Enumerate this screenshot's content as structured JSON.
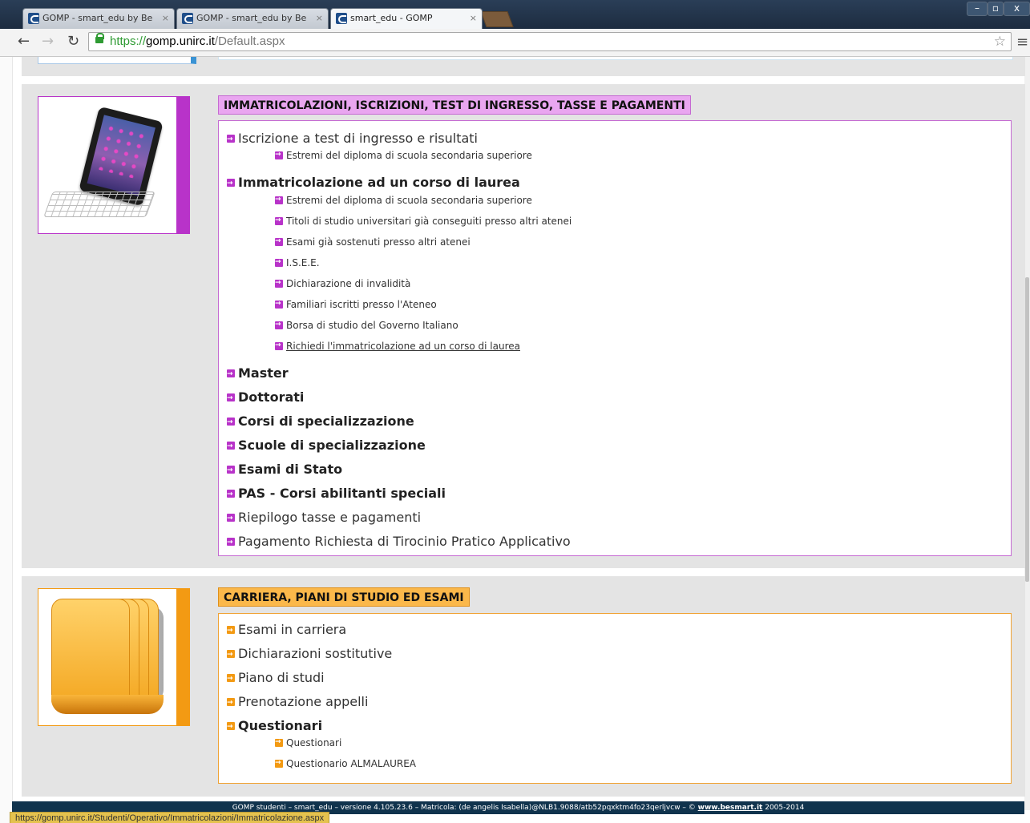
{
  "browser": {
    "tabs": [
      {
        "title": "GOMP - smart_edu by Be",
        "active": false
      },
      {
        "title": "GOMP - smart_edu by Be",
        "active": false
      },
      {
        "title": "smart_edu - GOMP",
        "active": true
      }
    ],
    "tab_close_glyph": "×",
    "url_scheme": "https://",
    "url_host": "gomp.unirc.it",
    "url_path": "/Default.aspx",
    "status_url": "https://gomp.unirc.it/Studenti/Operativo/Immatricolazioni/Immatricolazione.aspx"
  },
  "colors": {
    "purple_accent": "#b833c9",
    "purple_heading_bg": "#e9a6f0",
    "orange_accent": "#f39a13",
    "orange_heading_bg": "#fbb84a",
    "footer_bg": "#10334d"
  },
  "section_immatricolazioni": {
    "title": "IMMATRICOLAZIONI, ISCRIZIONI, TEST DI INGRESSO, TASSE E PAGAMENTI",
    "image_icon": "tablet-keyboard-icon",
    "items": {
      "test_ingresso": "Iscrizione a test di ingresso e risultati",
      "test_sub_diploma": "Estremi del diploma di scuola secondaria superiore",
      "immatricolazione": "Immatricolazione ad un corso di laurea",
      "imm_sub": [
        "Estremi del diploma di scuola secondaria superiore",
        "Titoli di studio universitari già conseguiti presso altri atenei",
        "Esami già sostenuti presso altri atenei",
        "I.S.E.E.",
        "Dichiarazione di invalidità",
        "Familiari iscritti presso l'Ateneo",
        "Borsa di studio del Governo Italiano",
        "Richiedi l'immatricolazione ad un corso di laurea"
      ],
      "master": "Master",
      "dottorati": "Dottorati",
      "corsi_spec": "Corsi di specializzazione",
      "scuole_spec": "Scuole di specializzazione",
      "esami_stato": "Esami di Stato",
      "pas": "PAS - Corsi abilitanti speciali",
      "riepilogo": "Riepilogo tasse e pagamenti",
      "tirocinio": "Pagamento Richiesta di Tirocinio Pratico Applicativo"
    }
  },
  "section_carriera": {
    "title": "CARRIERA, PIANI DI STUDIO ED ESAMI",
    "image_icon": "folders-icon",
    "items": {
      "esami": "Esami in carriera",
      "dichiarazioni": "Dichiarazioni sostitutive",
      "piano": "Piano di studi",
      "prenotazione": "Prenotazione appelli",
      "questionari": "Questionari",
      "q_sub": [
        "Questionari",
        "Questionario ALMALAUREA"
      ]
    }
  },
  "footer": {
    "text": "GOMP studenti – smart_edu – versione 4.105.23.6 – Matricola: (de angelis Isabella)@NLB1.9088/atb52pqxktm4fo23qerljvcw – ©",
    "link": "www.besmart.it",
    "years": "2005-2014"
  }
}
